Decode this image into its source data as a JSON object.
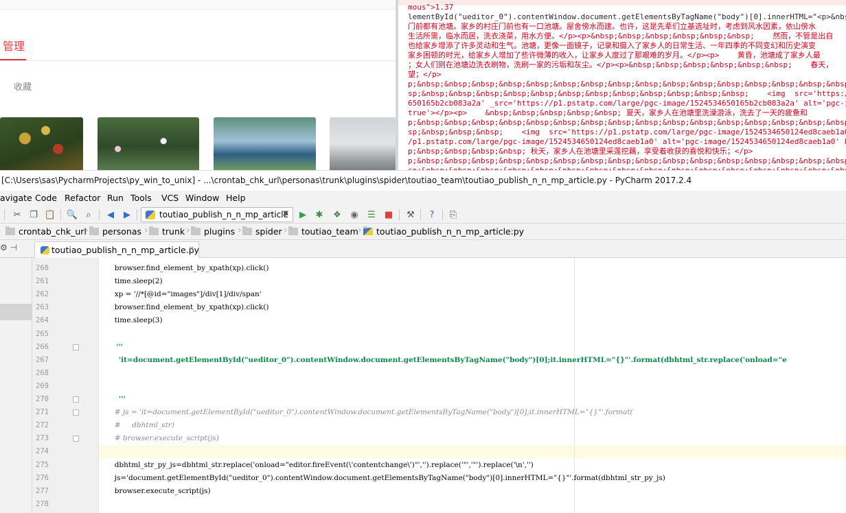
{
  "browser": {
    "nav_title": "管理",
    "favorites_label": "收藏"
  },
  "js_pane": {
    "lines": [
      {
        "text": "mous\">1.37",
        "color": "red"
      },
      {
        "text": "lementById(\"ueditor_0\").contentWindow.document.getElementsByTagName(\"body\")[0].innerHTML=\"<p>&nbsp;&nbsp;&nbsp;",
        "color": "mixed"
      },
      {
        "text": "门前都有池塘。家乡的村庄门前也有一口池塘。屋舍傍水而建。也许，这是先辈们立基选址时，考虑到风水因素，依山傍水",
        "color": "red"
      },
      {
        "text": "生活所需，临水而居，洗衣浇菜，用水方便。</p><p>&nbsp;&nbsp;&nbsp;&nbsp;&nbsp;&nbsp;    然而，不管是出自",
        "color": "red"
      },
      {
        "text": "也给家乡增添了许多灵动和生气。池塘，更像一面镜子，记录和摄入了家乡人的日常生活、一年四季的不同变幻和历史演变",
        "color": "red"
      },
      {
        "text": "家乡困顿的时光，给家乡人增加了些许微薄的收入，让家乡人度过了那艰难的岁月。</p><p>    黄昏，池塘成了家乡人最",
        "color": "red"
      },
      {
        "text": "；女人们则在池塘边洗衣刷物，洗刷一家的污垢和灰尘。</p><p>&nbsp;&nbsp;&nbsp;&nbsp;&nbsp;&nbsp;    春天，",
        "color": "red"
      },
      {
        "text": "望；</p>",
        "color": "red"
      },
      {
        "text": "p;&nbsp;&nbsp;&nbsp;&nbsp;&nbsp;&nbsp;&nbsp;&nbsp;&nbsp;&nbsp;&nbsp;&nbsp;&nbsp;&nbsp;&nbsp;&nbsp;&nbsp;&nbsp;&nbsp;",
        "color": "red"
      },
      {
        "text": "sp;&nbsp;&nbsp;&nbsp;&nbsp;&nbsp;&nbsp;&nbsp;&nbsp;&nbsp;&nbsp;&nbsp;&nbsp;    <img  src='https://p1.pstat",
        "color": "red"
      },
      {
        "text": "650165b2cb083a2a' _src='https://p1.pstatp.com/large/pgc-image/1524534650165b2cb083a2a' alt='pgc-ima",
        "color": "red"
      },
      {
        "text": "true'></p><p>    &nbsp;&nbsp;&nbsp;&nbsp;&nbsp; 夏天，家乡人在池塘里洗澡游泳，洗去了一天的疲惫和",
        "color": "red"
      },
      {
        "text": "p;&nbsp;&nbsp;&nbsp;&nbsp;&nbsp;&nbsp;&nbsp;&nbsp;&nbsp;&nbsp;&nbsp;&nbsp;&nbsp;&nbsp;&nbsp;&nbsp;&nbsp;&nbsp;&nbsp;",
        "color": "red"
      },
      {
        "text": "sp;&nbsp;&nbsp;&nbsp;    <img  src='https://p1.pstatp.com/large/pgc-image/1524534650124ed8caeb1a0",
        "color": "red"
      },
      {
        "text": "/p1.pstatp.com/large/pgc-image/1524534650124ed8caeb1a0' alt='pgc-image/1524534650124ed8caeb1a0' b",
        "color": "red"
      },
      {
        "text": "p;&nbsp;&nbsp;&nbsp;&nbsp; 秋天，家乡人在池塘里采莲挖藕，享受着收获的喜悦和快乐；</p>",
        "color": "red"
      },
      {
        "text": "p;&nbsp;&nbsp;&nbsp;&nbsp;&nbsp;&nbsp;&nbsp;&nbsp;&nbsp;&nbsp;&nbsp;&nbsp;&nbsp;&nbsp;&nbsp;&nbsp;&nbsp;&nbsp;&nbsp;",
        "color": "red"
      },
      {
        "text": "sp;&nbsp;&nbsp;&nbsp;&nbsp;&nbsp;&nbsp;&nbsp;&nbsp;&nbsp;&nbsp;&nbsp;&nbsp;&nbsp;&nbsp;&nbsp;&nbsp;&nbsp;&nbsp;&nbsp;",
        "color": "red"
      }
    ]
  },
  "ide": {
    "title": "[C:\\Users\\sas\\PycharmProjects\\py_win_to_unix] - ...\\crontab_chk_url\\personas\\trunk\\plugins\\spider\\toutiao_team\\toutiao_publish_n_n_mp_article.py - PyCharm 2017.2.4",
    "menu": [
      "avigate",
      "Code",
      "Refactor",
      "Run",
      "Tools",
      "VCS",
      "Window",
      "Help"
    ],
    "run_config": "toutiao_publish_n_n_mp_article",
    "breadcrumbs": [
      "crontab_chk_url",
      "personas",
      "trunk",
      "plugins",
      "spider",
      "toutiao_team",
      "toutiao_publish_n_n_mp_article.py"
    ],
    "tab": "toutiao_publish_n_n_mp_article.py",
    "accent_color": "#0b8a4b",
    "caret_line": 274,
    "code_lines": [
      {
        "num": "260",
        "text": "        browser.find_element_by_xpath(xp).click()"
      },
      {
        "num": "261",
        "text": "        time.sleep(2)"
      },
      {
        "num": "262",
        "text": "        xp = '//*[@id=\"images\"]/div[1]/div/span'"
      },
      {
        "num": "263",
        "text": "        browser.find_element_by_xpath(xp).click()"
      },
      {
        "num": "264",
        "text": "        time.sleep(3)"
      },
      {
        "num": "265",
        "text": ""
      },
      {
        "num": "266",
        "text": "        '''"
      },
      {
        "num": "267",
        "text": "         'it=document.getElementById(\"ueditor_0\").contentWindow.document.getElementsByTagName(\"body\")[0];it.innerHTML=\"{}\"'.format(dbhtml_str.replace('onload=\"e"
      },
      {
        "num": "268",
        "text": ""
      },
      {
        "num": "269",
        "text": ""
      },
      {
        "num": "270",
        "text": "         '''"
      },
      {
        "num": "271",
        "text": "        # js = 'it=document.getElementById(\"ueditor_0\").contentWindow.document.getElementsByTagName(\"body\")[0];it.innerHTML=\"{}\"'.format("
      },
      {
        "num": "272",
        "text": "        #     dbhtml_str)"
      },
      {
        "num": "273",
        "text": "        # browser.execute_script(js)"
      },
      {
        "num": "274",
        "text": ""
      },
      {
        "num": "275",
        "text": "        dbhtml_str_py_js=dbhtml_str.replace('onload=\"editor.fireEvent(\\'contentchange\\')\"','').replace('\"','\"').replace('\\n','')"
      },
      {
        "num": "276",
        "text": "        js='document.getElementById(\"ueditor_0\").contentWindow.document.getElementsByTagName(\"body\")[0].innerHTML=\"{}\"'.format(dbhtml_str_py_js)"
      },
      {
        "num": "277",
        "text": "        browser.execute_script(js)"
      },
      {
        "num": "278",
        "text": ""
      }
    ]
  }
}
